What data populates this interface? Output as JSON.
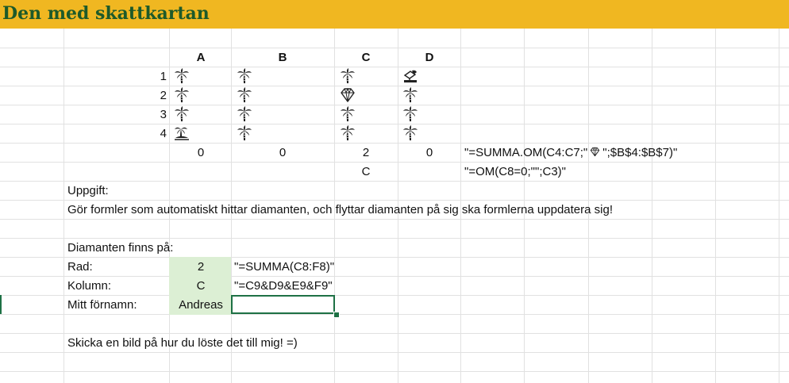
{
  "title": "Den med skattkartan",
  "headers": {
    "a": "A",
    "b": "B",
    "c": "C",
    "d": "D"
  },
  "row_numbers": [
    "1",
    "2",
    "3",
    "4"
  ],
  "map": {
    "r1": [
      "palm",
      "palm",
      "palm",
      "flag"
    ],
    "r2": [
      "palm",
      "palm",
      "diamond",
      "palm"
    ],
    "r3": [
      "palm",
      "palm",
      "palm",
      "palm"
    ],
    "r4": [
      "island",
      "palm",
      "palm",
      "palm"
    ]
  },
  "sums": [
    "0",
    "0",
    "2",
    "0"
  ],
  "sum_formula_before": "\"=SUMMA.OM(C4:C7;\"",
  "sum_formula_after": "\";$B$4:$B$7)\"",
  "column_result": "C",
  "if_formula": "\"=OM(C8=0;\"\";C3)\"",
  "task_heading": "Uppgift:",
  "task_text": "Gör formler som automatiskt hittar diamanten, och flyttar diamanten på sig ska formlerna uppdatera sig!",
  "found_heading": "Diamanten finns på:",
  "row_label": "Rad:",
  "row_value": "2",
  "row_formula": "\"=SUMMA(C8:F8)\"",
  "col_label": "Kolumn:",
  "col_value": "C",
  "col_formula": "\"=C9&D9&E9&F9\"",
  "name_label": "Mitt förnamn:",
  "name_value": "Andreas",
  "footer_text": "Skicka en bild på hur du löste det till mig! =)",
  "colors": {
    "banner": "#f0b721",
    "title": "#1d5a2a",
    "fill": "#dcefd4",
    "selection": "#1e7145"
  }
}
